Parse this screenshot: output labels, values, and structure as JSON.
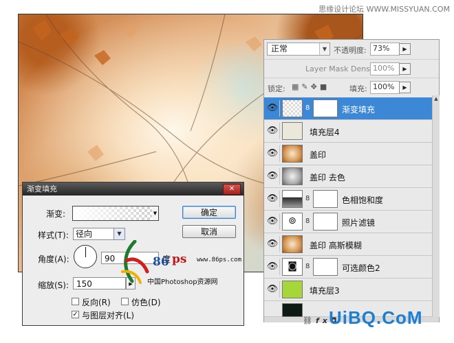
{
  "watermark_top": "思缘设计论坛 WWW.MISSYUAN.COM",
  "layers_panel": {
    "blend_mode": "正常",
    "opacity_label": "不透明度:",
    "opacity_value": "73%",
    "layer_mask_density_label": "Layer Mask Density",
    "layer_mask_density_value": "100%",
    "lock_label": "锁定:",
    "fill_label": "填充:",
    "fill_value": "100%",
    "layers": [
      {
        "name": "渐变填充",
        "thumb": "gradient-fill",
        "has_mask": true,
        "selected": true
      },
      {
        "name": "填充层4",
        "thumb": "solid-cream",
        "has_mask": false,
        "selected": false
      },
      {
        "name": "盖印",
        "thumb": "photo",
        "has_mask": false,
        "selected": false
      },
      {
        "name": "盖印 去色",
        "thumb": "photo-gray",
        "has_mask": false,
        "selected": false
      },
      {
        "name": "色相饱和度",
        "thumb": "hue-sat-adjustment",
        "has_mask": true,
        "selected": false
      },
      {
        "name": "照片滤镜",
        "thumb": "photo-filter-adjustment",
        "has_mask": true,
        "selected": false
      },
      {
        "name": "盖印 高斯模糊",
        "thumb": "photo",
        "has_mask": false,
        "selected": false
      },
      {
        "name": "可选颜色2",
        "thumb": "selective-color-adjustment",
        "has_mask": true,
        "selected": false
      },
      {
        "name": "填充层3",
        "thumb": "solid-green",
        "has_mask": false,
        "selected": false
      }
    ]
  },
  "dialog": {
    "title": "渐变填充",
    "gradient_label": "渐变:",
    "style_label": "样式(T):",
    "style_value": "径向",
    "angle_label": "角度(A):",
    "angle_value": "90",
    "angle_unit": "度",
    "scale_label": "缩放(S):",
    "scale_value": "150",
    "scale_unit": "%",
    "reverse_label": "反向(R)",
    "reverse_checked": false,
    "dither_label": "仿色(D)",
    "dither_checked": false,
    "align_label": "与图层对齐(L)",
    "align_checked": true,
    "ok_label": "确定",
    "cancel_label": "取消"
  },
  "logo": {
    "brand_number": "86",
    "brand_letters": "ps",
    "site": "www.86ps.com",
    "subtitle": "中国Photoshop资源网"
  },
  "watermark_bottom": "UiBQ.CoM",
  "colors": {
    "selection_blue": "#3c87d6",
    "dialog_title_bg": "#2b2b2b",
    "fill_layer3_green": "#a6d63a",
    "fill_layer4_cream": "#ebe8d9"
  }
}
